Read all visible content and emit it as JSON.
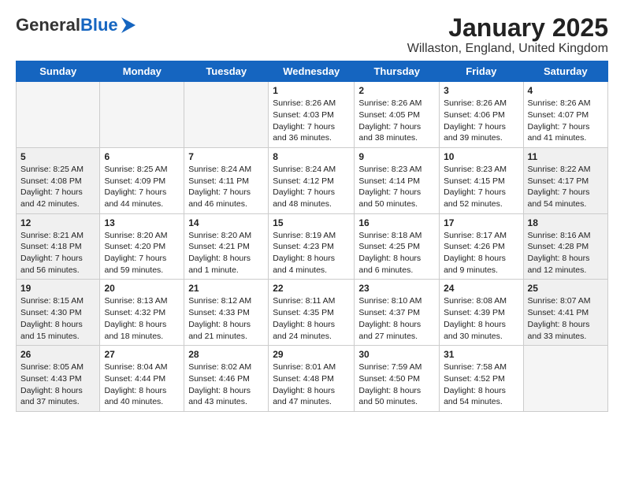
{
  "header": {
    "logo_general": "General",
    "logo_blue": "Blue",
    "title": "January 2025",
    "subtitle": "Willaston, England, United Kingdom"
  },
  "weekdays": [
    "Sunday",
    "Monday",
    "Tuesday",
    "Wednesday",
    "Thursday",
    "Friday",
    "Saturday"
  ],
  "weeks": [
    [
      {
        "day": "",
        "info": "",
        "shaded": true
      },
      {
        "day": "",
        "info": "",
        "shaded": true
      },
      {
        "day": "",
        "info": "",
        "shaded": true
      },
      {
        "day": "1",
        "info": "Sunrise: 8:26 AM\nSunset: 4:03 PM\nDaylight: 7 hours\nand 36 minutes.",
        "shaded": false
      },
      {
        "day": "2",
        "info": "Sunrise: 8:26 AM\nSunset: 4:05 PM\nDaylight: 7 hours\nand 38 minutes.",
        "shaded": false
      },
      {
        "day": "3",
        "info": "Sunrise: 8:26 AM\nSunset: 4:06 PM\nDaylight: 7 hours\nand 39 minutes.",
        "shaded": false
      },
      {
        "day": "4",
        "info": "Sunrise: 8:26 AM\nSunset: 4:07 PM\nDaylight: 7 hours\nand 41 minutes.",
        "shaded": false
      }
    ],
    [
      {
        "day": "5",
        "info": "Sunrise: 8:25 AM\nSunset: 4:08 PM\nDaylight: 7 hours\nand 42 minutes.",
        "shaded": true
      },
      {
        "day": "6",
        "info": "Sunrise: 8:25 AM\nSunset: 4:09 PM\nDaylight: 7 hours\nand 44 minutes.",
        "shaded": false
      },
      {
        "day": "7",
        "info": "Sunrise: 8:24 AM\nSunset: 4:11 PM\nDaylight: 7 hours\nand 46 minutes.",
        "shaded": false
      },
      {
        "day": "8",
        "info": "Sunrise: 8:24 AM\nSunset: 4:12 PM\nDaylight: 7 hours\nand 48 minutes.",
        "shaded": false
      },
      {
        "day": "9",
        "info": "Sunrise: 8:23 AM\nSunset: 4:14 PM\nDaylight: 7 hours\nand 50 minutes.",
        "shaded": false
      },
      {
        "day": "10",
        "info": "Sunrise: 8:23 AM\nSunset: 4:15 PM\nDaylight: 7 hours\nand 52 minutes.",
        "shaded": false
      },
      {
        "day": "11",
        "info": "Sunrise: 8:22 AM\nSunset: 4:17 PM\nDaylight: 7 hours\nand 54 minutes.",
        "shaded": true
      }
    ],
    [
      {
        "day": "12",
        "info": "Sunrise: 8:21 AM\nSunset: 4:18 PM\nDaylight: 7 hours\nand 56 minutes.",
        "shaded": true
      },
      {
        "day": "13",
        "info": "Sunrise: 8:20 AM\nSunset: 4:20 PM\nDaylight: 7 hours\nand 59 minutes.",
        "shaded": false
      },
      {
        "day": "14",
        "info": "Sunrise: 8:20 AM\nSunset: 4:21 PM\nDaylight: 8 hours\nand 1 minute.",
        "shaded": false
      },
      {
        "day": "15",
        "info": "Sunrise: 8:19 AM\nSunset: 4:23 PM\nDaylight: 8 hours\nand 4 minutes.",
        "shaded": false
      },
      {
        "day": "16",
        "info": "Sunrise: 8:18 AM\nSunset: 4:25 PM\nDaylight: 8 hours\nand 6 minutes.",
        "shaded": false
      },
      {
        "day": "17",
        "info": "Sunrise: 8:17 AM\nSunset: 4:26 PM\nDaylight: 8 hours\nand 9 minutes.",
        "shaded": false
      },
      {
        "day": "18",
        "info": "Sunrise: 8:16 AM\nSunset: 4:28 PM\nDaylight: 8 hours\nand 12 minutes.",
        "shaded": true
      }
    ],
    [
      {
        "day": "19",
        "info": "Sunrise: 8:15 AM\nSunset: 4:30 PM\nDaylight: 8 hours\nand 15 minutes.",
        "shaded": true
      },
      {
        "day": "20",
        "info": "Sunrise: 8:13 AM\nSunset: 4:32 PM\nDaylight: 8 hours\nand 18 minutes.",
        "shaded": false
      },
      {
        "day": "21",
        "info": "Sunrise: 8:12 AM\nSunset: 4:33 PM\nDaylight: 8 hours\nand 21 minutes.",
        "shaded": false
      },
      {
        "day": "22",
        "info": "Sunrise: 8:11 AM\nSunset: 4:35 PM\nDaylight: 8 hours\nand 24 minutes.",
        "shaded": false
      },
      {
        "day": "23",
        "info": "Sunrise: 8:10 AM\nSunset: 4:37 PM\nDaylight: 8 hours\nand 27 minutes.",
        "shaded": false
      },
      {
        "day": "24",
        "info": "Sunrise: 8:08 AM\nSunset: 4:39 PM\nDaylight: 8 hours\nand 30 minutes.",
        "shaded": false
      },
      {
        "day": "25",
        "info": "Sunrise: 8:07 AM\nSunset: 4:41 PM\nDaylight: 8 hours\nand 33 minutes.",
        "shaded": true
      }
    ],
    [
      {
        "day": "26",
        "info": "Sunrise: 8:05 AM\nSunset: 4:43 PM\nDaylight: 8 hours\nand 37 minutes.",
        "shaded": true
      },
      {
        "day": "27",
        "info": "Sunrise: 8:04 AM\nSunset: 4:44 PM\nDaylight: 8 hours\nand 40 minutes.",
        "shaded": false
      },
      {
        "day": "28",
        "info": "Sunrise: 8:02 AM\nSunset: 4:46 PM\nDaylight: 8 hours\nand 43 minutes.",
        "shaded": false
      },
      {
        "day": "29",
        "info": "Sunrise: 8:01 AM\nSunset: 4:48 PM\nDaylight: 8 hours\nand 47 minutes.",
        "shaded": false
      },
      {
        "day": "30",
        "info": "Sunrise: 7:59 AM\nSunset: 4:50 PM\nDaylight: 8 hours\nand 50 minutes.",
        "shaded": false
      },
      {
        "day": "31",
        "info": "Sunrise: 7:58 AM\nSunset: 4:52 PM\nDaylight: 8 hours\nand 54 minutes.",
        "shaded": false
      },
      {
        "day": "",
        "info": "",
        "shaded": true
      }
    ]
  ]
}
